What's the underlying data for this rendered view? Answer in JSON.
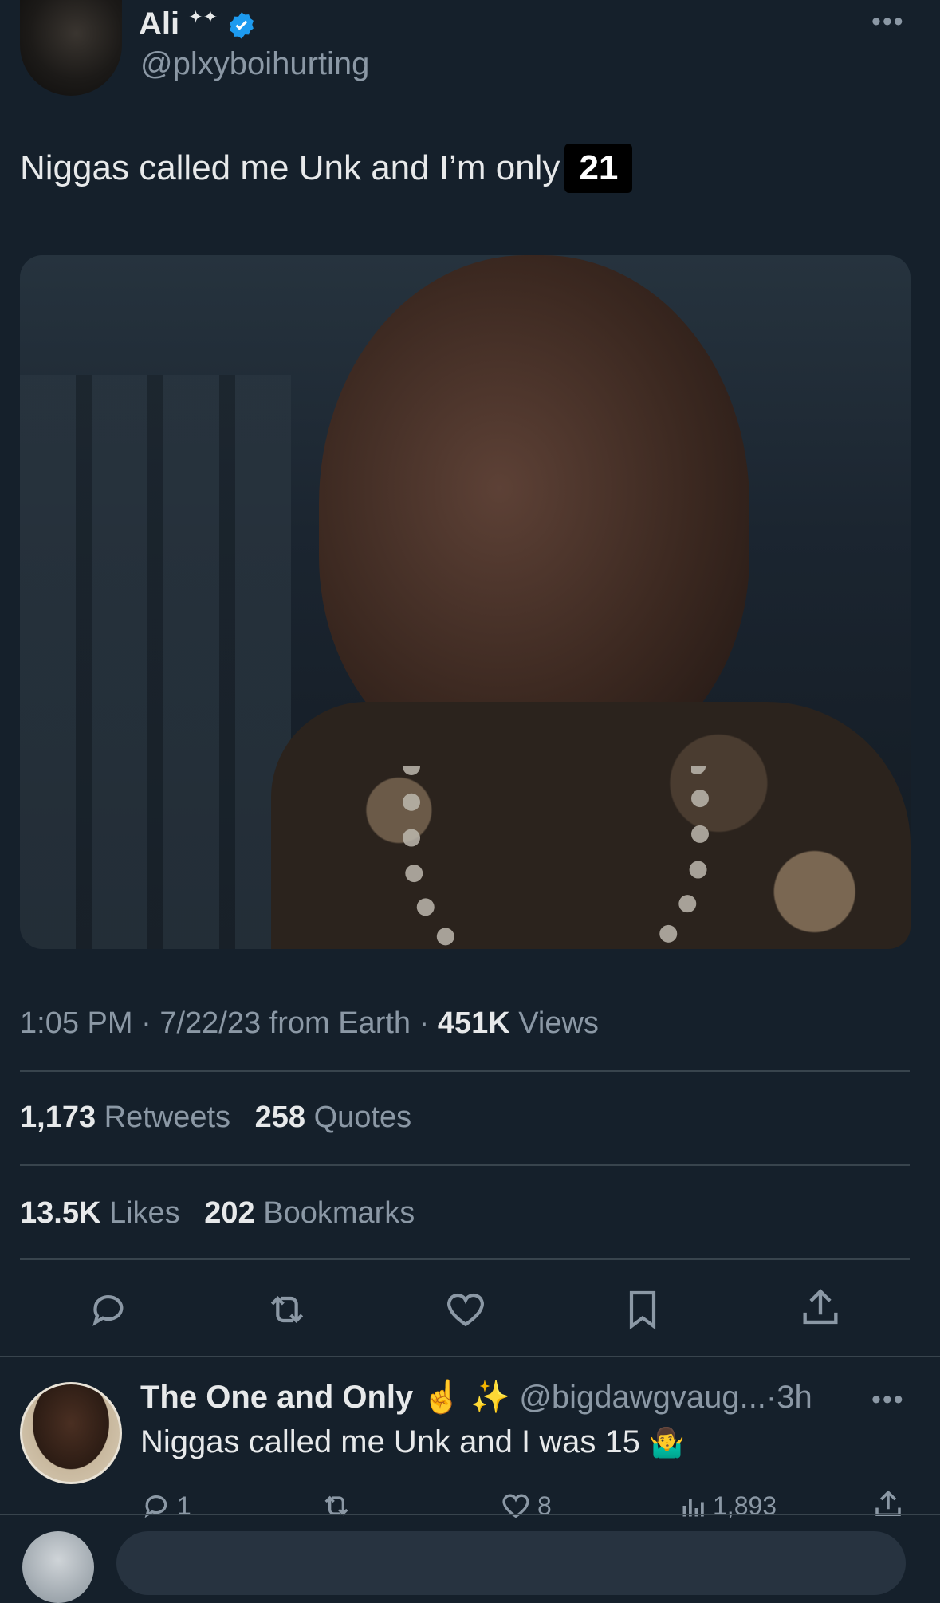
{
  "tweet": {
    "author_name": "Ali",
    "author_badges": "✦✦",
    "handle": "@plxyboihurting",
    "text": "Niggas called me Unk and I’m only",
    "highlight": "21",
    "time": "1:05 PM",
    "date": "7/22/23 from Earth",
    "sep": "·",
    "views_count": "451K",
    "views_label": "Views",
    "retweets_count": "1,173",
    "retweets_label": "Retweets",
    "quotes_count": "258",
    "quotes_label": "Quotes",
    "likes_count": "13.5K",
    "likes_label": "Likes",
    "bookmarks_count": "202",
    "bookmarks_label": "Bookmarks"
  },
  "actions": {
    "reply_icon": "reply-icon",
    "retweet_icon": "retweet-icon",
    "like_icon": "heart-icon",
    "bookmark_icon": "bookmark-icon",
    "share_icon": "share-icon"
  },
  "reply": {
    "name": "The One and Only ☝️ ✨",
    "handle": "@bigdawgvaug...",
    "time": "·3h",
    "text": "Niggas called me Unk and I was 15",
    "emoji": "🤷‍♂️",
    "reply_count": "1",
    "like_count": "8",
    "views_count": "1,893"
  },
  "colors": {
    "background": "#15202b",
    "verified": "#1d9bf0",
    "text": "#e7e9ea",
    "muted": "#8b98a5"
  }
}
